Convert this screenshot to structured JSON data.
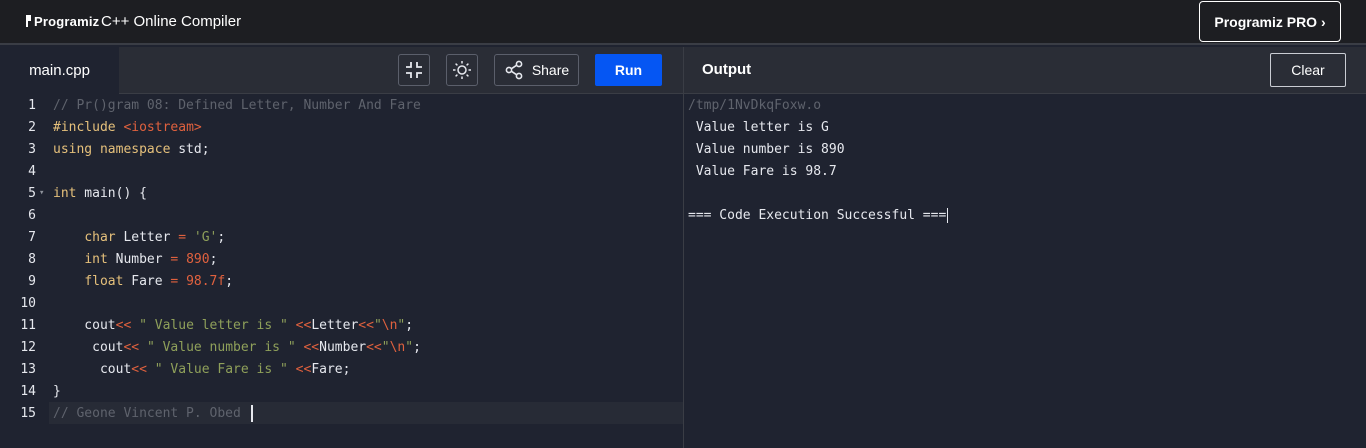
{
  "header": {
    "logo_text": "Programiz",
    "app_title": "C++ Online Compiler",
    "pro_button_label": "Programiz PRO ›"
  },
  "editor": {
    "file_tab": "main.cpp",
    "share_label": "Share",
    "run_label": "Run",
    "icons": [
      "collapse-icon",
      "theme-icon",
      "share-icon"
    ]
  },
  "output_panel": {
    "title": "Output",
    "clear_label": "Clear",
    "lines": [
      {
        "text": "/tmp/1NvDkqFoxw.o",
        "type": "path"
      },
      {
        "text": " Value letter is G",
        "type": "text"
      },
      {
        "text": " Value number is 890",
        "type": "text"
      },
      {
        "text": " Value Fare is 98.7",
        "type": "text"
      },
      {
        "text": "",
        "type": "text"
      },
      {
        "text": "=== Code Execution Successful ===",
        "type": "text"
      }
    ]
  },
  "code_lines": [
    {
      "n": "1",
      "tokens": [
        [
          "c",
          "// Pr()gram 08: Defined Letter, Number And Fare"
        ]
      ]
    },
    {
      "n": "2",
      "tokens": [
        [
          "k",
          "#include "
        ],
        [
          "i",
          "<iostream>"
        ]
      ]
    },
    {
      "n": "3",
      "tokens": [
        [
          "k",
          "using namespace"
        ],
        [
          "t",
          " std;"
        ]
      ]
    },
    {
      "n": "4",
      "tokens": []
    },
    {
      "n": "5",
      "fold": true,
      "tokens": [
        [
          "k",
          "int"
        ],
        [
          "t",
          " main() {"
        ]
      ]
    },
    {
      "n": "6",
      "tokens": []
    },
    {
      "n": "7",
      "tokens": [
        [
          "t",
          "    "
        ],
        [
          "k",
          "char"
        ],
        [
          "t",
          " Letter "
        ],
        [
          "o",
          "="
        ],
        [
          "t",
          " "
        ],
        [
          "s",
          "'G'"
        ],
        [
          "t",
          ";"
        ]
      ]
    },
    {
      "n": "8",
      "tokens": [
        [
          "t",
          "    "
        ],
        [
          "k",
          "int"
        ],
        [
          "t",
          " Number "
        ],
        [
          "o",
          "="
        ],
        [
          "t",
          " "
        ],
        [
          "u",
          "890"
        ],
        [
          "t",
          ";"
        ]
      ]
    },
    {
      "n": "9",
      "tokens": [
        [
          "t",
          "    "
        ],
        [
          "k",
          "float"
        ],
        [
          "t",
          " Fare "
        ],
        [
          "o",
          "="
        ],
        [
          "t",
          " "
        ],
        [
          "u",
          "98.7f"
        ],
        [
          "t",
          ";"
        ]
      ]
    },
    {
      "n": "10",
      "tokens": []
    },
    {
      "n": "11",
      "tokens": [
        [
          "t",
          "    cout"
        ],
        [
          "o",
          "<<"
        ],
        [
          "t",
          " "
        ],
        [
          "s",
          "\" Value letter is \""
        ],
        [
          "t",
          " "
        ],
        [
          "o",
          "<<"
        ],
        [
          "t",
          "Letter"
        ],
        [
          "o",
          "<<"
        ],
        [
          "s",
          "\""
        ],
        [
          "o",
          "\\n"
        ],
        [
          "s",
          "\""
        ],
        [
          "t",
          ";"
        ]
      ]
    },
    {
      "n": "12",
      "tokens": [
        [
          "t",
          "     cout"
        ],
        [
          "o",
          "<<"
        ],
        [
          "t",
          " "
        ],
        [
          "s",
          "\" Value number is \""
        ],
        [
          "t",
          " "
        ],
        [
          "o",
          "<<"
        ],
        [
          "t",
          "Number"
        ],
        [
          "o",
          "<<"
        ],
        [
          "s",
          "\""
        ],
        [
          "o",
          "\\n"
        ],
        [
          "s",
          "\""
        ],
        [
          "t",
          ";"
        ]
      ]
    },
    {
      "n": "13",
      "tokens": [
        [
          "t",
          "      cout"
        ],
        [
          "o",
          "<<"
        ],
        [
          "t",
          " "
        ],
        [
          "s",
          "\" Value Fare is \""
        ],
        [
          "t",
          " "
        ],
        [
          "o",
          "<<"
        ],
        [
          "t",
          "Fare;"
        ]
      ]
    },
    {
      "n": "14",
      "tokens": [
        [
          "t",
          "}"
        ]
      ]
    },
    {
      "n": "15",
      "active": true,
      "caret": true,
      "tokens": [
        [
          "c",
          "// Geone Vincent P. Obed "
        ]
      ]
    }
  ],
  "colors": {
    "run_button": "#0556f3",
    "background": "#1f2330",
    "toolbar": "#2a2d36",
    "keyword": "#e5c07b",
    "string": "#8fa05a",
    "number": "#e0613e",
    "comment": "#5f636d"
  }
}
